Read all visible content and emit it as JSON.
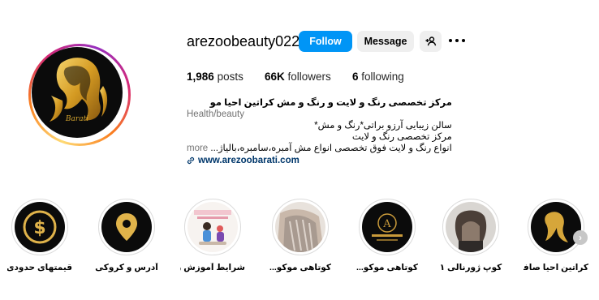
{
  "profile": {
    "username": "arezoobeauty022",
    "avatar_logo_text": "Barati"
  },
  "actions": {
    "follow_label": "Follow",
    "message_label": "Message",
    "add_user_icon": "person-plus-icon",
    "more_icon": "more-horizontal-icon"
  },
  "stats": {
    "posts_count": "1,986",
    "posts_label": "posts",
    "followers_count": "66K",
    "followers_label": "followers",
    "following_count": "6",
    "following_label": "following"
  },
  "bio": {
    "name": "مرکز تخصصی رنگ و لایت و رنگ و مش کراتین احیا مو",
    "category": "Health/beauty",
    "lines": [
      "سالن زیبایی آرزو براتی*رنگ و مش*",
      "مرکز تخصصی رنگ و لایت",
      "انواع رنگ و لایت فوق تخصصی انواع مش آمبره،سامبره،بالیاژ..."
    ],
    "more_label": "more",
    "link": "www.arezoobarati.com"
  },
  "highlights": [
    {
      "label": "قیمتهای حدودی",
      "icon": "dollar-coin-icon"
    },
    {
      "label": "آدرس و کروکی",
      "icon": "location-pin-icon"
    },
    {
      "label": "شرایط آموزش ر..."
    },
    {
      "label": "کوتاهی موکو..."
    },
    {
      "label": "کوتاهی موکو..."
    },
    {
      "label": "کوپ ژورنالی ۱"
    },
    {
      "label": "کراتین احیا صافی"
    }
  ],
  "colors": {
    "accent_blue": "#0095f6",
    "link_blue": "#00376b",
    "gold": "#d7a72f",
    "muted": "#737373",
    "button_gray": "#efefef"
  }
}
